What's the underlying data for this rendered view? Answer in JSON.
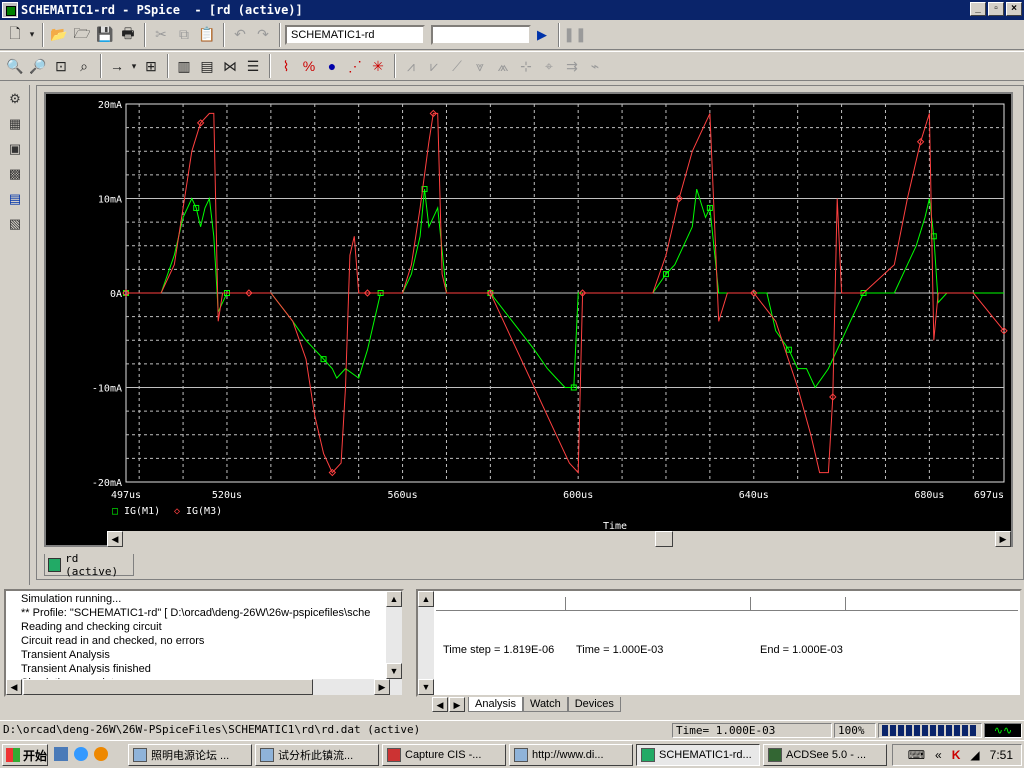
{
  "window": {
    "title": "SCHEMATIC1-rd - PSpice  - [rd (active)]",
    "controls": [
      "_",
      "▫",
      "×"
    ]
  },
  "toolbar1": {
    "profile_value": "SCHEMATIC1-rd",
    "sim_value": ""
  },
  "plot": {
    "legend": [
      {
        "marker": "□",
        "name": "IG(M1)"
      },
      {
        "marker": "◇",
        "name": "IG(M3)"
      }
    ],
    "colors": {
      "background": "#000000",
      "grid": "#c0c0c0",
      "series1": "#00ff00",
      "series2": "#ff4040",
      "text": "#ffffff"
    }
  },
  "chart_data": {
    "type": "line",
    "xlabel": "Time",
    "ylabel": "",
    "x_unit": "us",
    "xlim": [
      497,
      697
    ],
    "ylim": [
      -20,
      20
    ],
    "x_ticks": [
      "497us",
      "520us",
      "560us",
      "600us",
      "640us",
      "680us",
      "697us"
    ],
    "y_ticks": [
      "20mA",
      "10mA",
      "0A",
      "-10mA",
      "-20mA"
    ],
    "grid": true,
    "legend_position": "bottom-left",
    "series": [
      {
        "name": "IG(M1)",
        "color": "#00ff00",
        "x": [
          497,
          500,
          505,
          508,
          510,
          512,
          513,
          514,
          515,
          516,
          517,
          518,
          520,
          525,
          530,
          535,
          538,
          540,
          542,
          544,
          545,
          547,
          550,
          552,
          555,
          557,
          560,
          562,
          563,
          564,
          565,
          566,
          567,
          568,
          570,
          575,
          580,
          585,
          590,
          593,
          595,
          597,
          599,
          600,
          602,
          605,
          610,
          617,
          620,
          622,
          624,
          626,
          627,
          629,
          630,
          632,
          635,
          640,
          643,
          645,
          648,
          650,
          652,
          654,
          657,
          660,
          665,
          672,
          675,
          677,
          679,
          680,
          681,
          682,
          684,
          690,
          697
        ],
        "y": [
          0,
          0,
          0,
          4,
          8,
          10,
          9,
          7,
          9,
          10,
          6,
          -2,
          0,
          0,
          0,
          -3,
          -5,
          -6,
          -7,
          -8,
          -9,
          -8,
          -9,
          -6,
          0,
          0,
          0,
          2,
          4,
          6,
          11,
          7,
          8,
          9,
          0,
          0,
          0,
          -3,
          -6,
          -8,
          -9,
          -10,
          -10,
          0,
          0,
          0,
          0,
          0,
          2,
          3,
          5,
          7,
          11,
          8,
          9,
          0,
          0,
          0,
          0,
          -4,
          -6,
          -8,
          -8,
          -10,
          -8,
          -5,
          0,
          0,
          3,
          5,
          8,
          10,
          6,
          -1,
          0,
          0,
          0
        ]
      },
      {
        "name": "IG(M3)",
        "color": "#ff4040",
        "x": [
          497,
          500,
          505,
          508,
          510,
          512,
          514,
          516,
          517,
          518,
          519,
          520,
          525,
          530,
          535,
          538,
          540,
          542,
          544,
          546,
          547,
          548,
          549,
          550,
          552,
          555,
          560,
          562,
          564,
          566,
          567,
          568,
          569,
          570,
          572,
          575,
          580,
          585,
          590,
          595,
          598,
          600,
          601,
          602,
          605,
          610,
          617,
          620,
          623,
          626,
          629,
          630,
          632,
          634,
          640,
          645,
          650,
          653,
          655,
          657,
          658,
          659,
          660,
          665,
          672,
          675,
          678,
          680,
          681,
          682,
          684,
          690,
          697
        ],
        "y": [
          0,
          0,
          0,
          3,
          9,
          15,
          18,
          19,
          19,
          -3,
          0,
          0,
          0,
          0,
          -3,
          -7,
          -13,
          -17,
          -19,
          -18,
          -10,
          4,
          6,
          0,
          0,
          0,
          0,
          3,
          9,
          16,
          19,
          19,
          2,
          0,
          0,
          0,
          0,
          -5,
          -10,
          -15,
          -18,
          -19,
          0,
          0,
          0,
          0,
          0,
          4,
          10,
          15,
          18,
          19,
          -3,
          0,
          0,
          -3,
          -10,
          -15,
          -19,
          -19,
          -11,
          10,
          0,
          0,
          3,
          10,
          16,
          19,
          -5,
          0,
          0,
          0,
          -4
        ]
      }
    ]
  },
  "scrollbar_tab": {
    "label": "rd (active)"
  },
  "output_log": [
    "Simulation running...",
    "** Profile: \"SCHEMATIC1-rd\"  [ D:\\orcad\\deng-26W\\26w-pspicefiles\\sche",
    "Reading and checking circuit",
    "Circuit read in and checked, no errors",
    "Transient Analysis",
    "Transient Analysis finished",
    "Simulation complete"
  ],
  "sim_status": {
    "time_step": "Time step =  1.819E-06",
    "time": "Time =  1.000E-03",
    "end": "End =  1.000E-03"
  },
  "bottom_tabs": [
    "Analysis",
    "Watch",
    "Devices"
  ],
  "status_bar": {
    "path": "D:\\orcad\\deng-26W\\26W-PSpiceFiles\\SCHEMATIC1\\rd\\rd.dat (active)",
    "time": "Time= 1.000E-03",
    "zoom": "100%"
  },
  "taskbar": {
    "start": "开始",
    "tasks": [
      "照明电源论坛 ...",
      "试分析此镇流...",
      "Capture CIS -...",
      "http://www.di...",
      "SCHEMATIC1-rd...",
      "ACDSee 5.0 - ..."
    ],
    "clock": "7:51"
  }
}
